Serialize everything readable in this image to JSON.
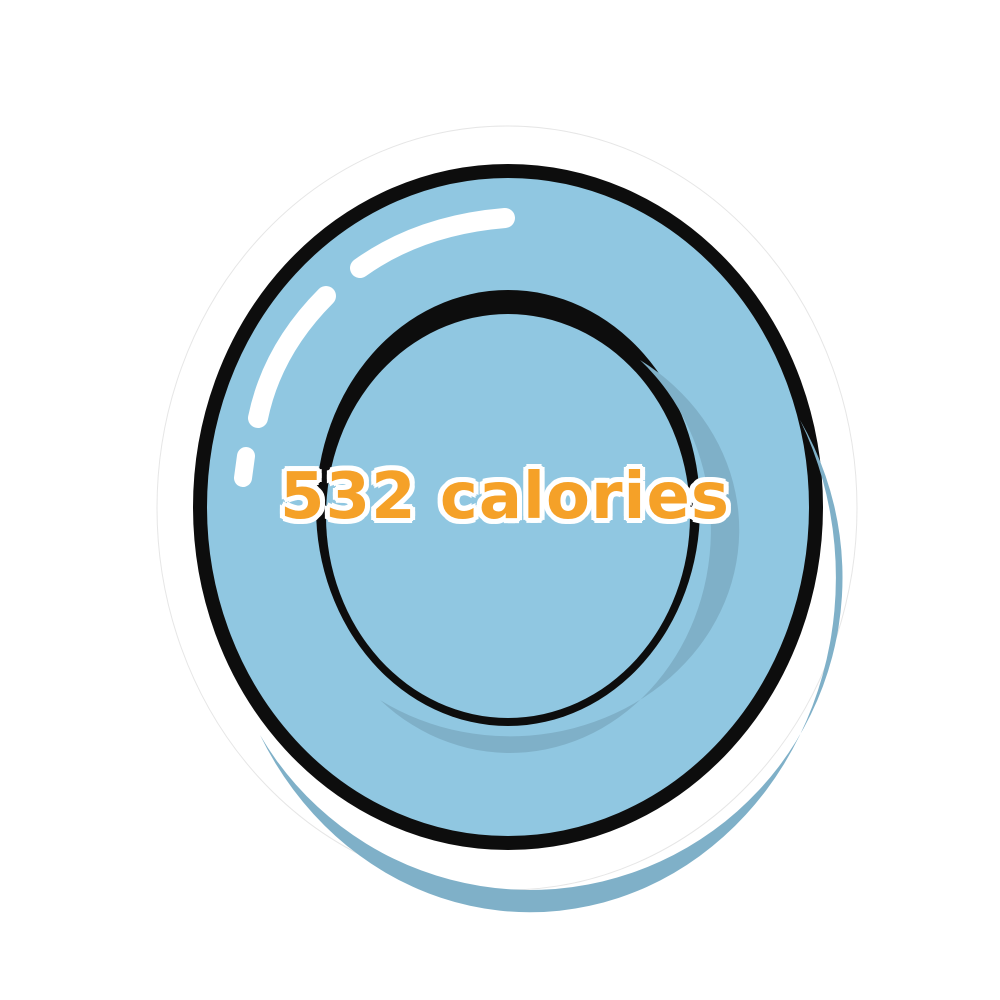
{
  "plate": {
    "label": "532 calories",
    "icon": "plate-icon",
    "colors": {
      "plate_fill": "#90c7e1",
      "plate_shade": "#7fb0c8",
      "outline": "#0d0d0d",
      "highlight": "#ffffff",
      "sticker_border": "#ffffff",
      "label_color": "#f5a128"
    }
  }
}
